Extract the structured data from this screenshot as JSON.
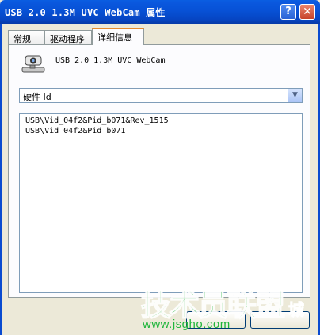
{
  "window": {
    "title": "USB 2.0 1.3M UVC WebCam 属性",
    "help_glyph": "?",
    "close_glyph": "✕"
  },
  "tabs": [
    {
      "label": "常规"
    },
    {
      "label": "驱动程序"
    },
    {
      "label": "详细信息"
    }
  ],
  "details": {
    "device_name": "USB 2.0 1.3M UVC WebCam",
    "property_selected": "硬件 Id",
    "values": [
      "USB\\Vid_04f2&Pid_b071&Rev_1515",
      "USB\\Vid_04f2&Pid_b071"
    ]
  },
  "buttons": {
    "ok_label": "",
    "cancel_label": ""
  },
  "watermark": {
    "text_green": "技术员联盟",
    "text_blue": "城",
    "url": "www.jsgho.com"
  },
  "icons": {
    "device": "webcam-icon",
    "dropdown": "chevron-down-icon"
  }
}
